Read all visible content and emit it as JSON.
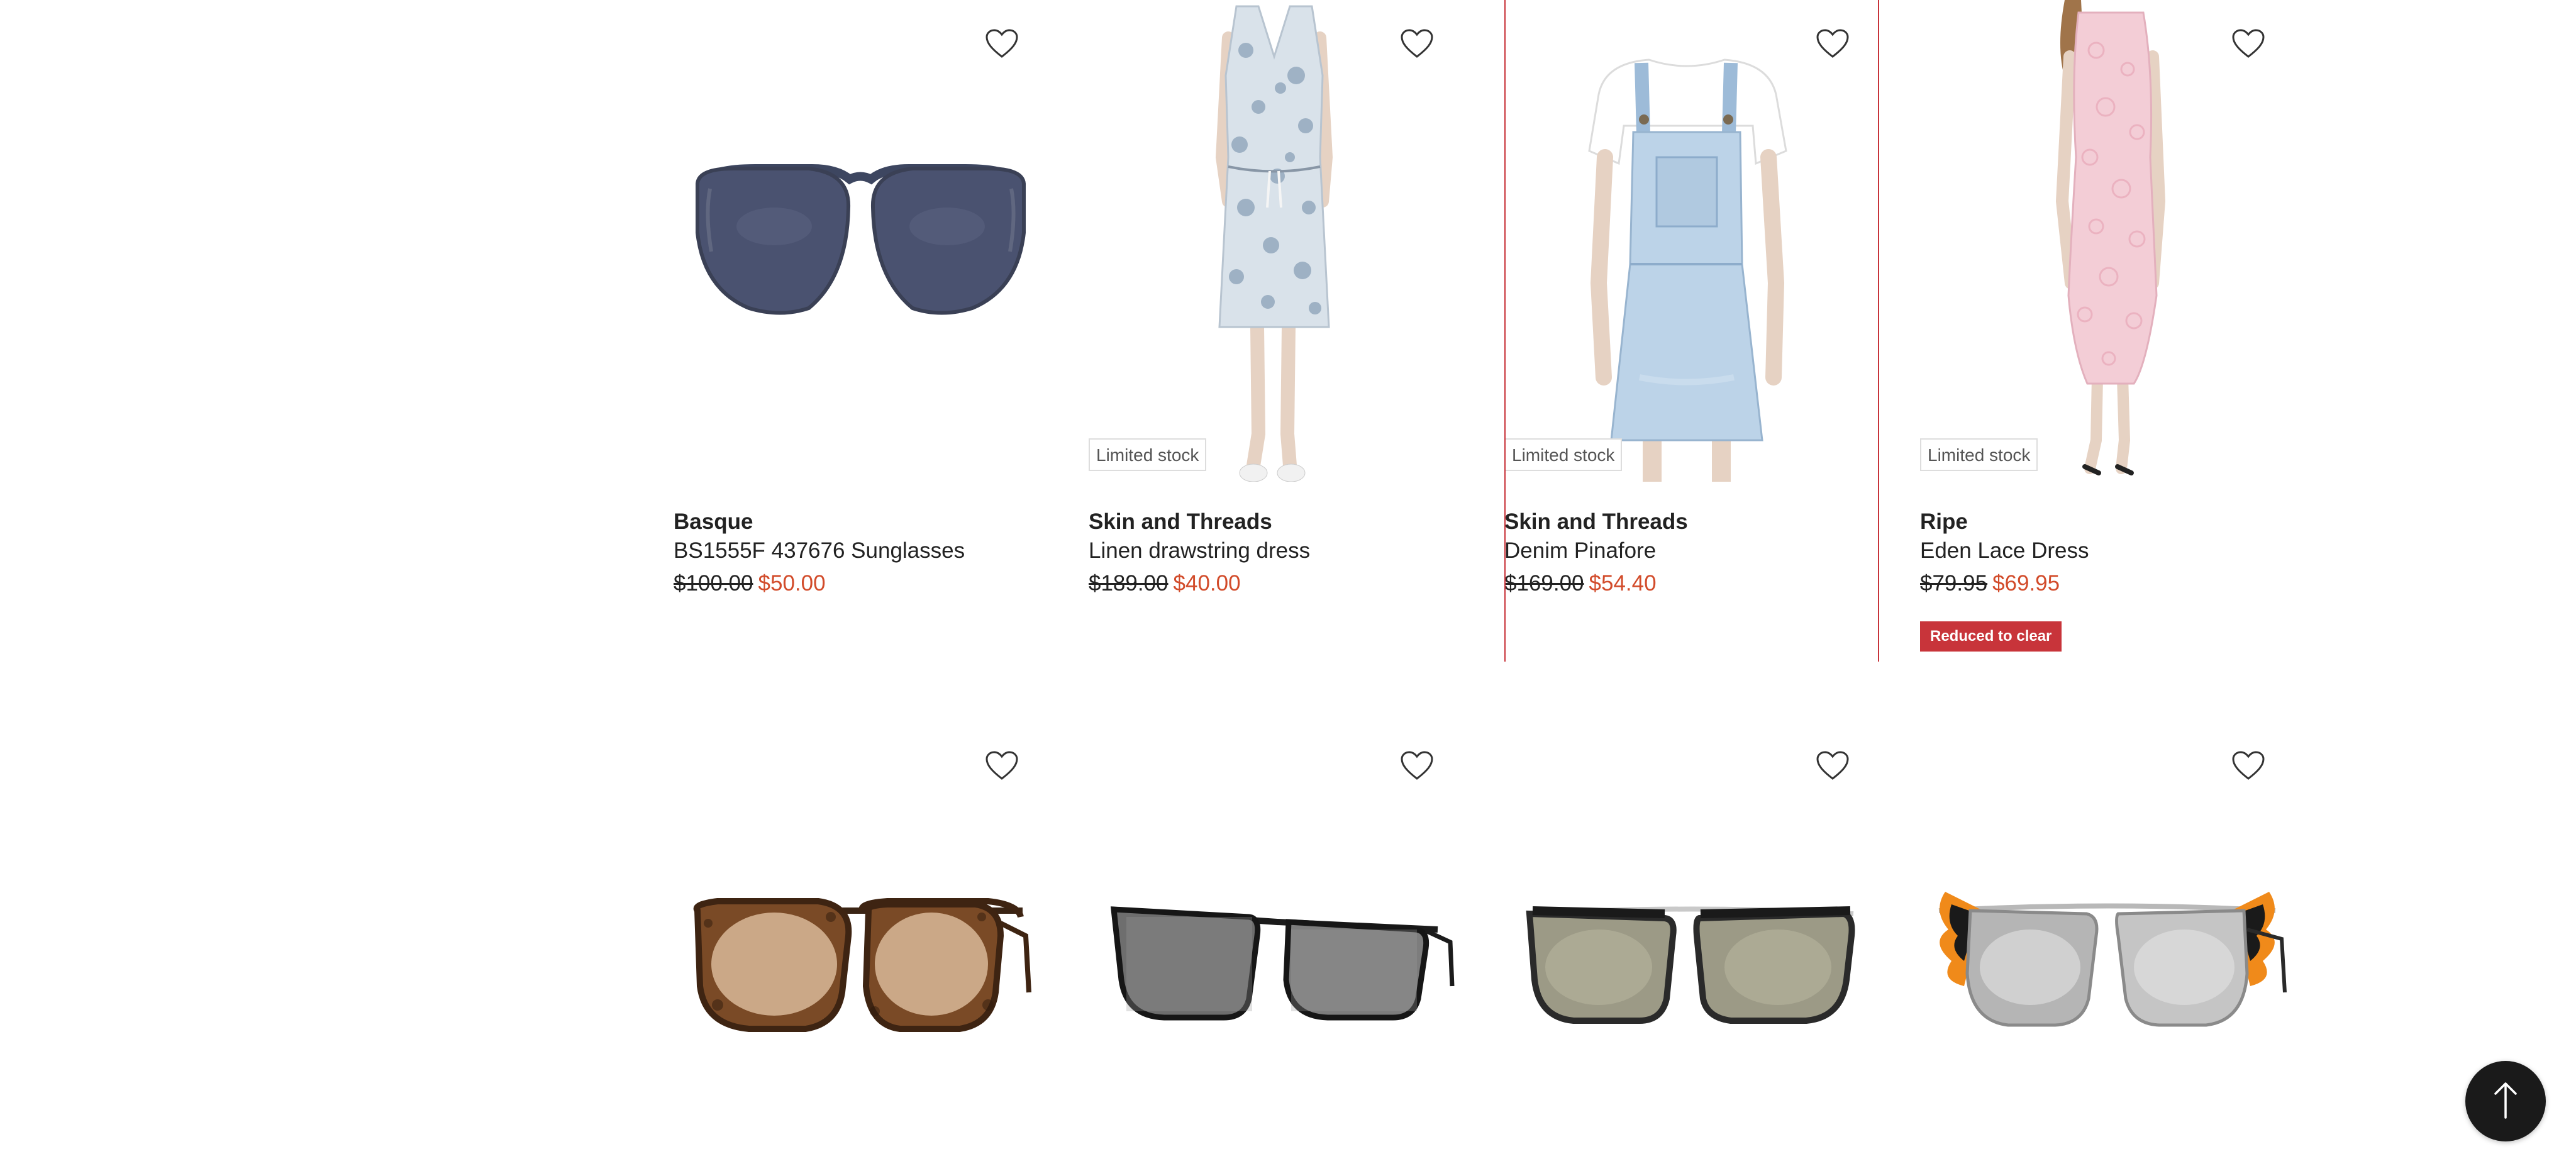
{
  "products": [
    {
      "brand": "Basque",
      "name": "BS1555F 437676 Sunglasses",
      "was_price": "$100.00",
      "now_price": "$50.00",
      "stock_label": "",
      "promo_label": ""
    },
    {
      "brand": "Skin and Threads",
      "name": "Linen drawstring dress",
      "was_price": "$189.00",
      "now_price": "$40.00",
      "stock_label": "Limited stock",
      "promo_label": ""
    },
    {
      "brand": "Skin and Threads",
      "name": "Denim Pinafore",
      "was_price": "$169.00",
      "now_price": "$54.40",
      "stock_label": "Limited stock",
      "promo_label": ""
    },
    {
      "brand": "Ripe",
      "name": "Eden Lace Dress",
      "was_price": "$79.95",
      "now_price": "$69.95",
      "stock_label": "Limited stock",
      "promo_label": "Reduced to clear"
    }
  ],
  "icons": {
    "wishlist": "heart-outline-icon",
    "back_to_top": "arrow-up-icon"
  },
  "colors": {
    "sale_price": "#d24b2a",
    "promo_badge": "#c8343a",
    "hover_border": "#c8343a",
    "back_to_top_bg": "#1a1a1a"
  }
}
